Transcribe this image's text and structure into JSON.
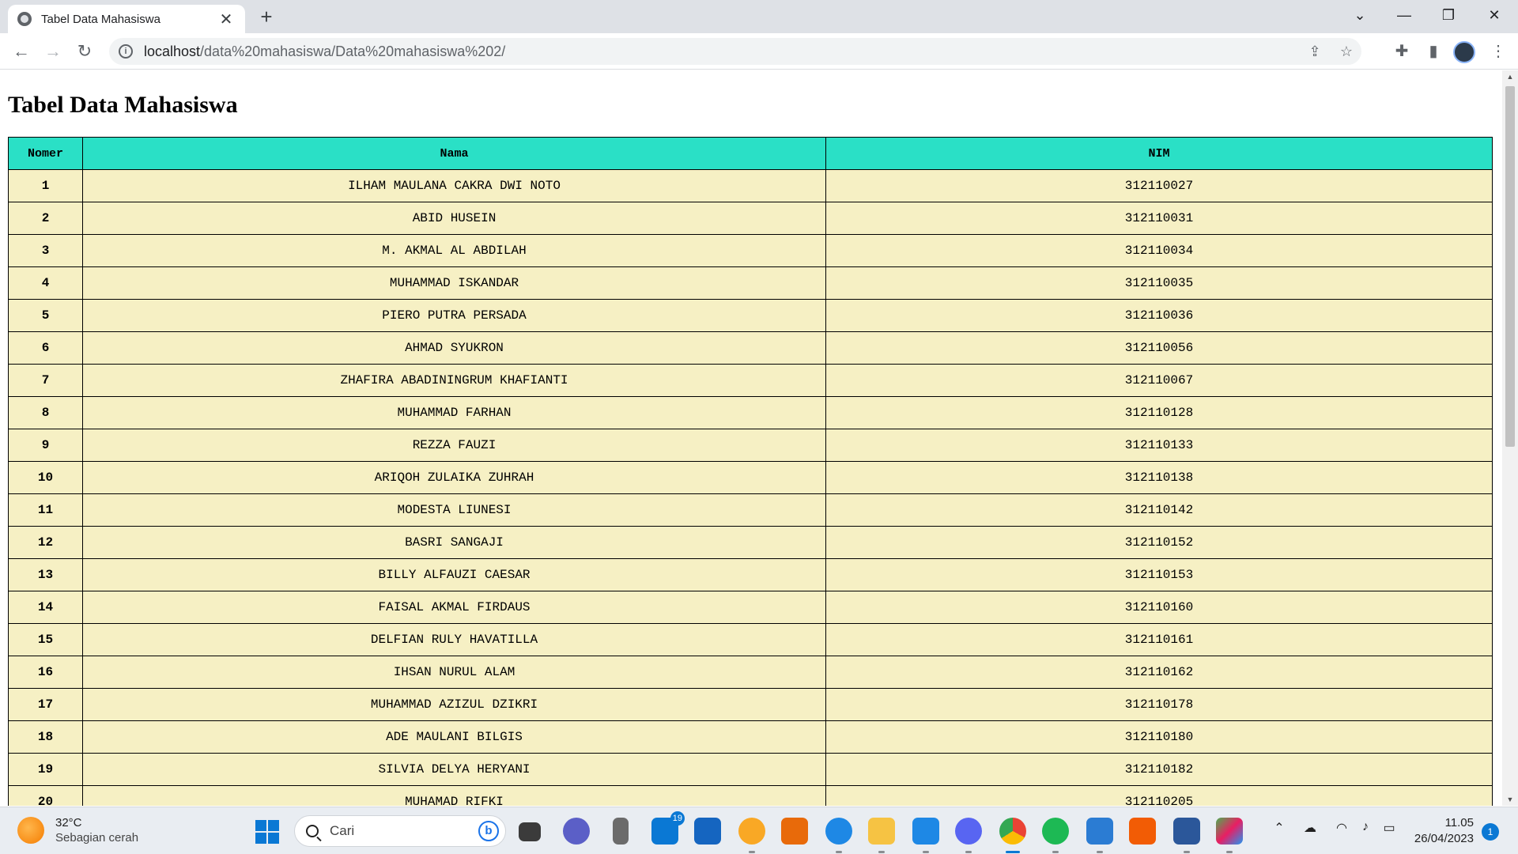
{
  "browser": {
    "tab_title": "Tabel Data Mahasiswa",
    "tab_close": "✕",
    "new_tab": "+",
    "url_host": "localhost",
    "url_path": "/data%20mahasiswa/Data%20mahasiswa%202/"
  },
  "page": {
    "title": "Tabel Data Mahasiswa",
    "table": {
      "headers": [
        "Nomer",
        "Nama",
        "NIM"
      ],
      "rows": [
        [
          "1",
          "ILHAM MAULANA CAKRA DWI NOTO",
          "312110027"
        ],
        [
          "2",
          "ABID HUSEIN",
          "312110031"
        ],
        [
          "3",
          "M. AKMAL AL ABDILAH",
          "312110034"
        ],
        [
          "4",
          "MUHAMMAD ISKANDAR",
          "312110035"
        ],
        [
          "5",
          "PIERO PUTRA PERSADA",
          "312110036"
        ],
        [
          "6",
          "AHMAD SYUKRON",
          "312110056"
        ],
        [
          "7",
          "ZHAFIRA ABADININGRUM KHAFIANTI",
          "312110067"
        ],
        [
          "8",
          "MUHAMMAD FARHAN",
          "312110128"
        ],
        [
          "9",
          "REZZA FAUZI",
          "312110133"
        ],
        [
          "10",
          "ARIQOH ZULAIKA ZUHRAH",
          "312110138"
        ],
        [
          "11",
          "MODESTA LIUNESI",
          "312110142"
        ],
        [
          "12",
          "BASRI SANGAJI",
          "312110152"
        ],
        [
          "13",
          "BILLY ALFAUZI CAESAR",
          "312110153"
        ],
        [
          "14",
          "FAISAL AKMAL FIRDAUS",
          "312110160"
        ],
        [
          "15",
          "DELFIAN RULY HAVATILLA",
          "312110161"
        ],
        [
          "16",
          "IHSAN NURUL ALAM",
          "312110162"
        ],
        [
          "17",
          "MUHAMMAD AZIZUL DZIKRI",
          "312110178"
        ],
        [
          "18",
          "ADE MAULANI BILGIS",
          "312110180"
        ],
        [
          "19",
          "SILVIA DELYA HERYANI",
          "312110182"
        ],
        [
          "20",
          "MUHAMAD RIFKI",
          "312110205"
        ]
      ]
    }
  },
  "taskbar": {
    "weather_temp": "32°C",
    "weather_condition": "Sebagian cerah",
    "search_placeholder": "Cari",
    "mail_badge": "19",
    "time": "11.05",
    "date": "26/04/2023",
    "notification_count": "1"
  },
  "colors": {
    "table_header": "#2ae0c6",
    "table_row": "#f6f0c4",
    "accent": "#0a78d4"
  }
}
